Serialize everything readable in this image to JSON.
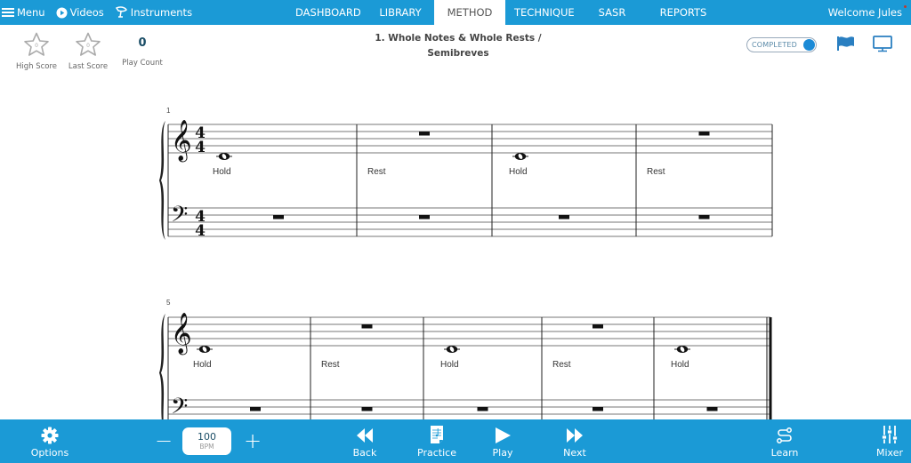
{
  "topbar": {
    "menu_label": "Menu",
    "videos_label": "Videos",
    "instruments_label": "Instruments",
    "tabs": [
      {
        "label": "DASHBOARD",
        "active": false
      },
      {
        "label": "LIBRARY",
        "active": false
      },
      {
        "label": "METHOD",
        "active": true
      },
      {
        "label": "TECHNIQUE",
        "active": false
      },
      {
        "label": "SASR",
        "active": false
      },
      {
        "label": "REPORTS",
        "active": false
      }
    ],
    "welcome": "Welcome Jules"
  },
  "stats": {
    "high_score": {
      "label": "High Score",
      "value": "0"
    },
    "last_score": {
      "label": "Last Score",
      "value": "0"
    },
    "play_count": {
      "label": "Play Count",
      "value": "0"
    }
  },
  "lesson": {
    "title_line1": "1. Whole Notes & Whole Rests /",
    "title_line2": "Semibreves",
    "completed_label": "COMPLETED",
    "completed": true
  },
  "icons": {
    "flag": "flag-icon",
    "display": "monitor-icon"
  },
  "score": {
    "time_signature": "4/4",
    "systems": [
      {
        "start_measure": "1",
        "show_time_signature": true,
        "measures": [
          {
            "treble": "whole-note",
            "lyric": "Hold",
            "bass": "whole-rest"
          },
          {
            "treble": "whole-rest",
            "lyric": "Rest",
            "bass": "whole-rest"
          },
          {
            "treble": "whole-note",
            "lyric": "Hold",
            "bass": "whole-rest"
          },
          {
            "treble": "whole-rest",
            "lyric": "Rest",
            "bass": "whole-rest"
          }
        ],
        "final_barline": false
      },
      {
        "start_measure": "5",
        "show_time_signature": false,
        "measures": [
          {
            "treble": "whole-note",
            "lyric": "Hold",
            "bass": "whole-rest"
          },
          {
            "treble": "whole-rest",
            "lyric": "Rest",
            "bass": "whole-rest"
          },
          {
            "treble": "whole-note",
            "lyric": "Hold",
            "bass": "whole-rest"
          },
          {
            "treble": "whole-rest",
            "lyric": "Rest",
            "bass": "whole-rest"
          },
          {
            "treble": "whole-note",
            "lyric": "Hold",
            "bass": "whole-rest"
          }
        ],
        "final_barline": true
      }
    ]
  },
  "bottombar": {
    "options_label": "Options",
    "tempo": {
      "value": "100",
      "unit": "BPM",
      "minus": "−",
      "plus": "+"
    },
    "back_label": "Back",
    "practice_label": "Practice",
    "play_label": "Play",
    "next_label": "Next",
    "learn_label": "Learn",
    "mixer_label": "Mixer"
  },
  "colors": {
    "brand": "#1b9ad6",
    "toggle_on": "#1b8ad6",
    "stat_number": "#1a4d66"
  }
}
